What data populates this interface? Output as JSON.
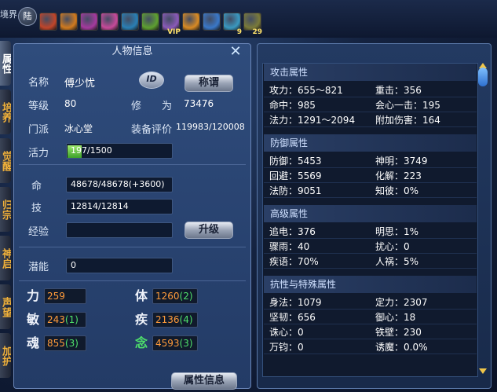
{
  "top": {
    "scene_tag": "境界",
    "land_button": "陆",
    "buffs": [
      {
        "icon": "rage-buff-icon",
        "color": "#c0452a",
        "level": "",
        "sub": ""
      },
      {
        "icon": "flame-buff-icon",
        "color": "#d07a1f",
        "level": "",
        "sub": ""
      },
      {
        "icon": "dragon-buff-icon",
        "color": "#a43a9e",
        "level": "",
        "sub": ""
      },
      {
        "icon": "feather-buff-icon",
        "color": "#c64a9a",
        "level": "",
        "sub": ""
      },
      {
        "icon": "shield-buff-icon",
        "color": "#2a7fb4",
        "level": "",
        "sub": ""
      },
      {
        "icon": "herb-buff-icon",
        "color": "#5ea030",
        "level": "",
        "sub": ""
      },
      {
        "icon": "vip-buff-icon",
        "color": "#8a5ab8",
        "level": "VIP",
        "sub": ""
      },
      {
        "icon": "sun-buff-icon",
        "color": "#d88a24",
        "level": "",
        "sub": ""
      },
      {
        "icon": "gem-buff-icon",
        "color": "#3a78c8",
        "level": "",
        "sub": ""
      },
      {
        "icon": "sword-buff-icon",
        "color": "#3a98c0",
        "level": "9",
        "sub": ""
      },
      {
        "icon": "blade-buff-icon",
        "color": "#7a7a3a",
        "level": "29",
        "sub": ""
      }
    ]
  },
  "side_tabs": [
    "属性",
    "培养",
    "觉醒",
    "归宗",
    "神启",
    "声望",
    "加护"
  ],
  "char": {
    "title": "人物信息",
    "name_label": "名称",
    "name": "傅少忧",
    "id_badge": "ID",
    "title_button": "称谓",
    "level_label": "等级",
    "level": "80",
    "cultivation_label": "修　　为",
    "cultivation": "73476",
    "sect_label": "门派",
    "sect": "冰心堂",
    "gear_label": "装备评价",
    "gear": "119983/120008",
    "vitality_label": "活力",
    "vitality_current": "197",
    "vitality_max": "/1500",
    "vitality_fraction": 0.131,
    "hp_label": "命",
    "hp": "48678/48678(+3600)",
    "skill_label": "技",
    "skill": "12814/12814",
    "exp_label": "经验",
    "exp": "",
    "upgrade_button": "升级",
    "potential_label": "潜能",
    "potential": "0",
    "stats": [
      {
        "label": "力",
        "value": "259",
        "bonus": ""
      },
      {
        "label": "体",
        "value": "1260",
        "bonus": "(2)"
      },
      {
        "label": "敏",
        "value": "243",
        "bonus": "(1)"
      },
      {
        "label": "疾",
        "value": "2136",
        "bonus": "(4)"
      },
      {
        "label": "魂",
        "value": "855",
        "bonus": "(3)"
      },
      {
        "label": "念",
        "value": "4593",
        "bonus": "(3)"
      }
    ],
    "attr_info_button": "属性信息"
  },
  "attrs": {
    "sections": [
      {
        "title": "攻击属性",
        "items": [
          [
            "攻力：655～821",
            "重击：356"
          ],
          [
            "命中：985",
            "会心一击：195"
          ],
          [
            "法力：1291～2094",
            "附加伤害：164"
          ]
        ]
      },
      {
        "title": "防御属性",
        "items": [
          [
            "防御：5453",
            "神明：3749"
          ],
          [
            "回避：5569",
            "化解：223"
          ],
          [
            "法防：9051",
            "知彼：0%"
          ]
        ]
      },
      {
        "title": "高级属性",
        "items": [
          [
            "追电：376",
            "明思：1%"
          ],
          [
            "骤雨：40",
            "扰心：0"
          ],
          [
            "疾语：70%",
            "人祸：5%"
          ]
        ]
      },
      {
        "title": "抗性与特殊属性",
        "items": [
          [
            "身法：1079",
            "定力：2307"
          ],
          [
            "坚韧：656",
            "御心：18"
          ],
          [
            "诛心：0",
            "铁壁：230"
          ],
          [
            "万钧：0",
            "诱魔：0.0%"
          ]
        ]
      }
    ]
  },
  "colors": {
    "stat_value": "#ff9b3a",
    "stat_bonus": "#4ee06a",
    "nian_label": "#4ee06a",
    "side_tab_text": "#f2b23a"
  }
}
